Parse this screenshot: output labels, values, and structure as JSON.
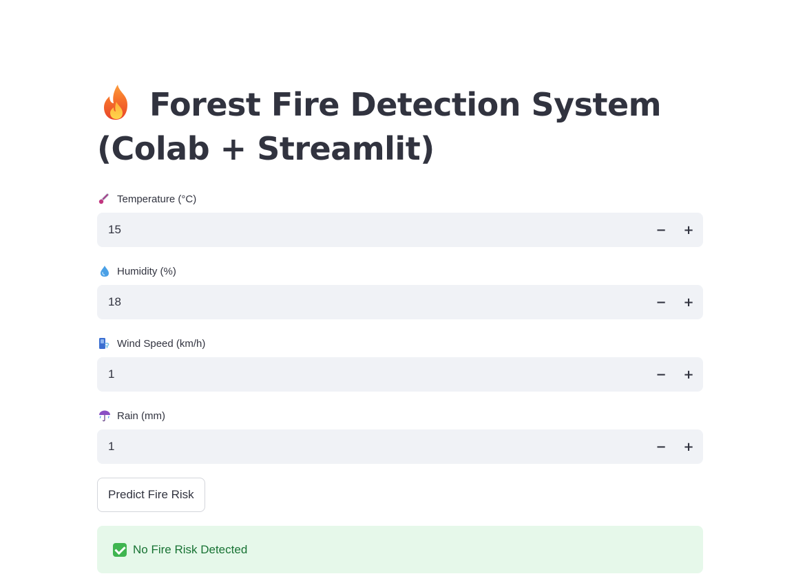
{
  "page": {
    "title": "Forest Fire Detection System (Colab + Streamlit)",
    "title_icon": "fire-icon"
  },
  "fields": [
    {
      "label": "Temperature (°C)",
      "icon": "thermometer-icon",
      "value": "15"
    },
    {
      "label": "Humidity (%)",
      "icon": "droplet-icon",
      "value": "18"
    },
    {
      "label": "Wind Speed (km/h)",
      "icon": "wind-icon",
      "value": "1"
    },
    {
      "label": "Rain (mm)",
      "icon": "umbrella-rain-icon",
      "value": "1"
    }
  ],
  "stepper": {
    "minus_label": "−",
    "plus_label": "+"
  },
  "predict_button": {
    "label": "Predict Fire Risk"
  },
  "result": {
    "status": "success",
    "icon": "check-mark-icon",
    "text": "No Fire Risk Detected"
  },
  "colors": {
    "input_bg": "#f0f2f6",
    "text": "#31333f",
    "success_bg": "#e6f8ea",
    "success_text": "#177233"
  }
}
